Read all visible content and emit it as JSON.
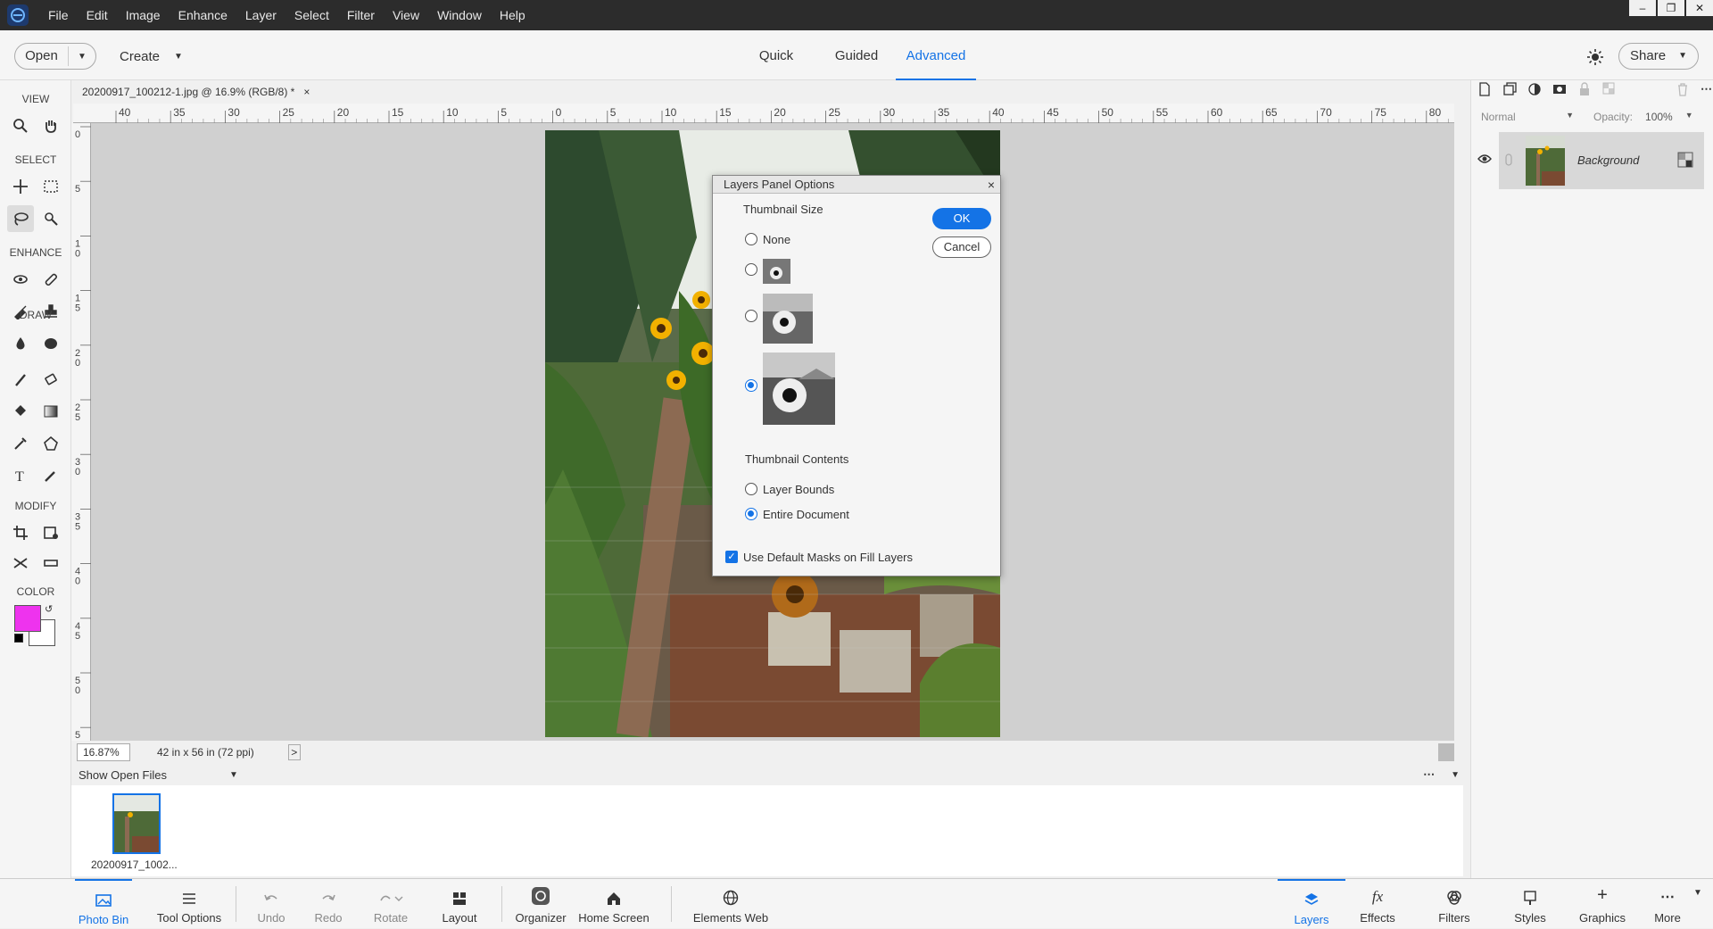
{
  "menubar": {
    "items": [
      "File",
      "Edit",
      "Image",
      "Enhance",
      "Layer",
      "Select",
      "Filter",
      "View",
      "Window",
      "Help"
    ],
    "window_controls": [
      "minimize",
      "restore",
      "close"
    ]
  },
  "topbar": {
    "open_label": "Open",
    "create_label": "Create",
    "modes": [
      "Quick",
      "Guided",
      "Advanced"
    ],
    "active_mode": "Advanced",
    "share_label": "Share"
  },
  "toolbar": {
    "sections": [
      "VIEW",
      "SELECT",
      "ENHANCE",
      "DRAW",
      "MODIFY",
      "COLOR"
    ],
    "foreground_color": "#ee33ee",
    "background_color": "#ffffff"
  },
  "document": {
    "tab_title": "20200917_100212-1.jpg @ 16.9% (RGB/8) *",
    "close_glyph": "×"
  },
  "rulers": {
    "top_labels": [
      "40",
      "35",
      "30",
      "25",
      "20",
      "15",
      "10",
      "5",
      "0",
      "5",
      "10",
      "15",
      "20",
      "25",
      "30",
      "35",
      "40",
      "45",
      "50",
      "55",
      "60",
      "65",
      "70",
      "75",
      "80"
    ],
    "left_labels": [
      "0",
      "5",
      "1\n0",
      "1\n5",
      "2\n0",
      "2\n5",
      "3\n0",
      "3\n5",
      "4\n0",
      "4\n5",
      "5\n0",
      "5"
    ]
  },
  "dialog": {
    "title": "Layers Panel Options",
    "close_glyph": "×",
    "thumbnail_size_label": "Thumbnail Size",
    "none_label": "None",
    "selected_size": "large",
    "ok_label": "OK",
    "cancel_label": "Cancel",
    "thumbnail_contents_label": "Thumbnail Contents",
    "layer_bounds_label": "Layer Bounds",
    "entire_document_label": "Entire Document",
    "selected_contents": "Entire Document",
    "default_masks_label": "Use Default Masks on Fill Layers",
    "default_masks_checked": true
  },
  "status": {
    "zoom": "16.87%",
    "doc_size": "42 in x 56 in (72 ppi)",
    "arrow": ">"
  },
  "photo_bin": {
    "dropdown_label": "Show Open Files",
    "item_label": "20200917_1002..."
  },
  "bottombar": {
    "photo_bin": "Photo Bin",
    "tool_options": "Tool Options",
    "undo": "Undo",
    "redo": "Redo",
    "rotate": "Rotate",
    "layout": "Layout",
    "organizer": "Organizer",
    "home_screen": "Home Screen",
    "elements_web": "Elements Web",
    "layers": "Layers",
    "effects": "Effects",
    "filters": "Filters",
    "styles": "Styles",
    "graphics": "Graphics",
    "more": "More"
  },
  "layers_panel": {
    "blend_mode": "Normal",
    "opacity_label": "Opacity:",
    "opacity_value": "100%",
    "layer_name": "Background"
  },
  "colors": {
    "accent": "#1473e6",
    "menubar_bg": "#2c2c2c",
    "canvas_bg": "#d0d0d0"
  }
}
